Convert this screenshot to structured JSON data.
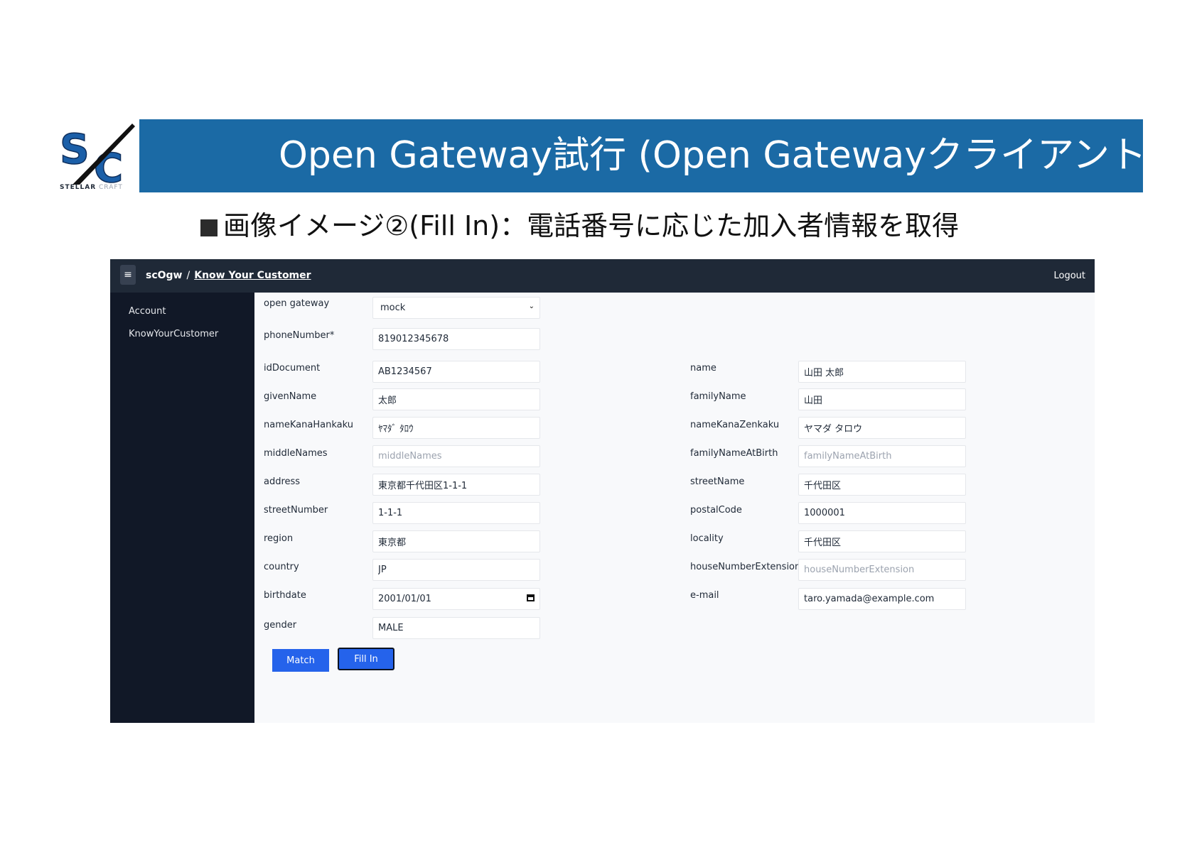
{
  "slide": {
    "title": "Open Gateway試行 (Open Gatewayクライアント開発)",
    "subtitle": "画像イメージ②(Fill In)：電話番号に応じた加入者情報を取得",
    "logo_text_bold": "STELLAR",
    "logo_text_light": "CRAFT"
  },
  "colors": {
    "slide_bar": "#1b6aa5",
    "topbar": "#1f2937",
    "sidebar": "#111827",
    "button": "#2563eb"
  },
  "topbar": {
    "menu_icon": "≡",
    "app_name": "scOgw",
    "separator": "/",
    "page": "Know Your Customer",
    "logout": "Logout"
  },
  "sidebar": {
    "items": [
      "Account",
      "KnowYourCustomer"
    ]
  },
  "form": {
    "open_gateway": {
      "label": "open gateway",
      "value": "mock",
      "options": [
        "mock"
      ]
    },
    "left": [
      {
        "label": "phoneNumber*",
        "value": "819012345678",
        "placeholder": ""
      },
      {
        "label": "idDocument",
        "value": "AB1234567",
        "placeholder": ""
      },
      {
        "label": "givenName",
        "value": "太郎",
        "placeholder": ""
      },
      {
        "label": "nameKanaHankaku",
        "value": "ﾔﾏﾀﾞ ﾀﾛｳ",
        "placeholder": ""
      },
      {
        "label": "middleNames",
        "value": "",
        "placeholder": "middleNames"
      },
      {
        "label": "address",
        "value": "東京都千代田区1-1-1",
        "placeholder": ""
      },
      {
        "label": "streetNumber",
        "value": "1-1-1",
        "placeholder": ""
      },
      {
        "label": "region",
        "value": "東京都",
        "placeholder": ""
      },
      {
        "label": "country",
        "value": "JP",
        "placeholder": ""
      },
      {
        "label": "birthdate",
        "value": "2001/01/01",
        "placeholder": ""
      },
      {
        "label": "gender",
        "value": "MALE",
        "placeholder": ""
      }
    ],
    "right": [
      {
        "label": "name",
        "value": "山田 太郎",
        "placeholder": ""
      },
      {
        "label": "familyName",
        "value": "山田",
        "placeholder": ""
      },
      {
        "label": "nameKanaZenkaku",
        "value": "ヤマダ タロウ",
        "placeholder": ""
      },
      {
        "label": "familyNameAtBirth",
        "value": "",
        "placeholder": "familyNameAtBirth"
      },
      {
        "label": "streetName",
        "value": "千代田区",
        "placeholder": ""
      },
      {
        "label": "postalCode",
        "value": "1000001",
        "placeholder": ""
      },
      {
        "label": "locality",
        "value": "千代田区",
        "placeholder": ""
      },
      {
        "label": "houseNumberExtension",
        "value": "",
        "placeholder": "houseNumberExtension"
      },
      {
        "label": "e-mail",
        "value": "taro.yamada@example.com",
        "placeholder": ""
      }
    ],
    "buttons": {
      "match": "Match",
      "fill_in": "Fill In"
    }
  }
}
